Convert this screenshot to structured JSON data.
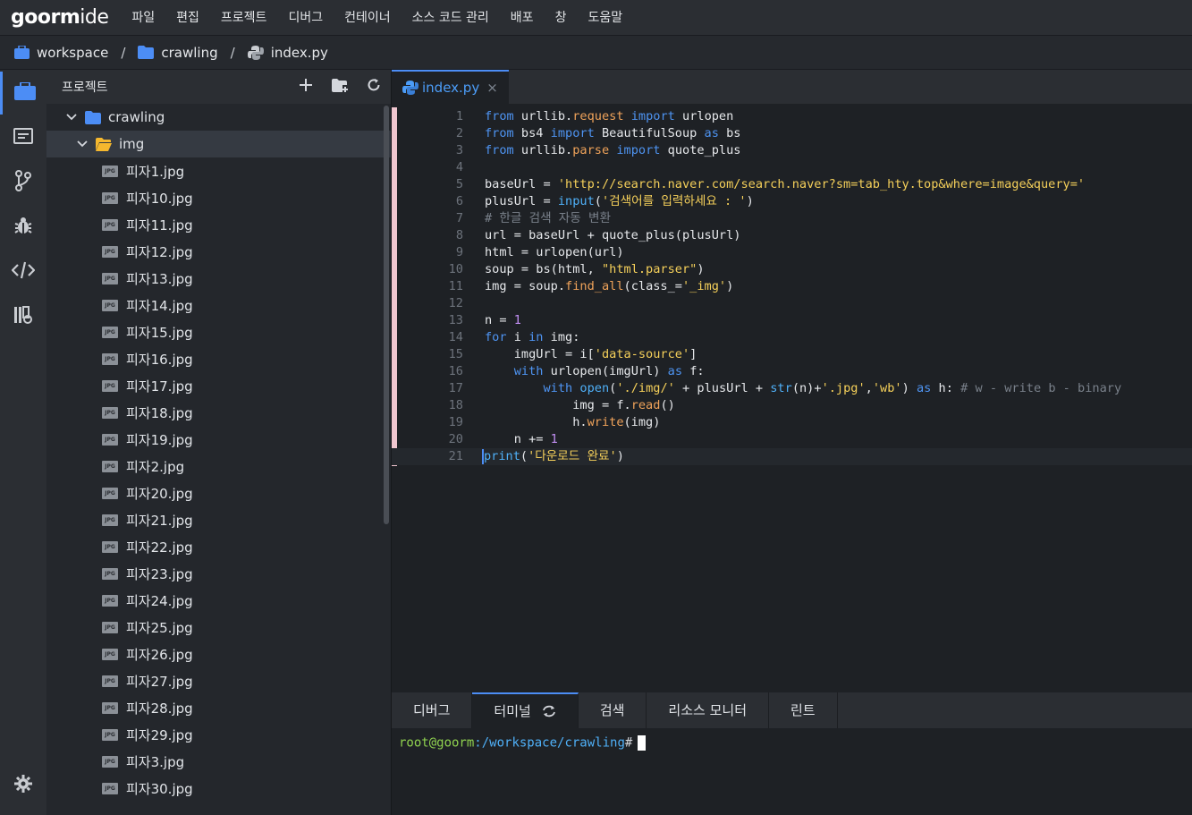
{
  "app": {
    "logo_main": "goorm",
    "logo_suffix": "ide"
  },
  "menu": [
    "파일",
    "편집",
    "프로젝트",
    "디버그",
    "컨테이너",
    "소스 코드 관리",
    "배포",
    "창",
    "도움말"
  ],
  "breadcrumb": {
    "items": [
      "workspace",
      "crawling",
      "index.py"
    ],
    "separator": "/"
  },
  "sidebar": {
    "title": "프로젝트",
    "root_folder": "crawling",
    "sub_folder": "img",
    "file_type_badge": "JPG",
    "files": [
      "피자1.jpg",
      "피자10.jpg",
      "피자11.jpg",
      "피자12.jpg",
      "피자13.jpg",
      "피자14.jpg",
      "피자15.jpg",
      "피자16.jpg",
      "피자17.jpg",
      "피자18.jpg",
      "피자19.jpg",
      "피자2.jpg",
      "피자20.jpg",
      "피자21.jpg",
      "피자22.jpg",
      "피자23.jpg",
      "피자24.jpg",
      "피자25.jpg",
      "피자26.jpg",
      "피자27.jpg",
      "피자28.jpg",
      "피자29.jpg",
      "피자3.jpg",
      "피자30.jpg"
    ]
  },
  "editor": {
    "tab_label": "index.py",
    "tab_close": "×",
    "line_count": 21
  },
  "panel": {
    "tabs": [
      "디버그",
      "터미널",
      "검색",
      "리소스 모니터",
      "린트"
    ],
    "active_tab": "터미널"
  },
  "terminal": {
    "user": "root@goorm",
    "path": ":/workspace/crawling",
    "prompt": "#"
  },
  "colors": {
    "accent": "#4c8df5",
    "keyword": "#4e94f2",
    "string": "#f5d05a",
    "method": "#f0a35a",
    "folder_yellow": "#f5b82e",
    "folder_blue": "#4c8df5"
  }
}
